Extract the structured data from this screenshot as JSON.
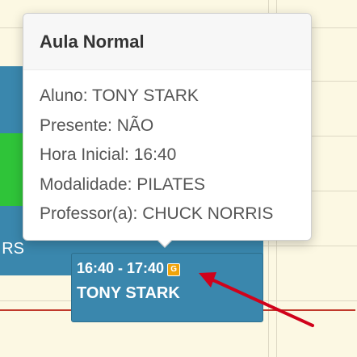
{
  "event": {
    "time": "16:40 - 17:40",
    "badge": "G",
    "name": "TONY STARK"
  },
  "left_panel": {
    "clipped_text": "RS"
  },
  "popover": {
    "title": "Aula Normal",
    "rows": [
      "Aluno: TONY STARK",
      "Presente: NÃO",
      "Hora Inicial: 16:40",
      "Modalidade: PILATES",
      "Professor(a): CHUCK NORRIS"
    ]
  },
  "colors": {
    "background": "#fcf8e3",
    "event_blue": "#3a87ad",
    "event_green": "#2fc439",
    "badge_orange": "#f0a30a",
    "annotation_red": "#d0021b"
  },
  "icons": {
    "badge": "letter-g-badge",
    "annotation": "red-arrow-annotation"
  }
}
